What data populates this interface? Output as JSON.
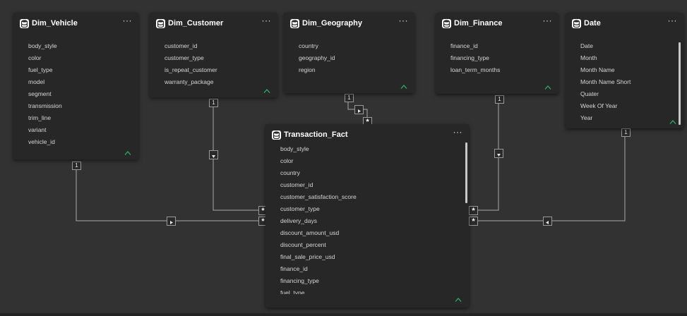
{
  "tables": {
    "dim_vehicle": {
      "title": "Dim_Vehicle",
      "fields": [
        "body_style",
        "color",
        "fuel_type",
        "model",
        "segment",
        "transmission",
        "trim_line",
        "variant",
        "vehicle_id"
      ]
    },
    "dim_customer": {
      "title": "Dim_Customer",
      "fields": [
        "customer_id",
        "customer_type",
        "is_repeat_customer",
        "warranty_package"
      ]
    },
    "dim_geography": {
      "title": "Dim_Geography",
      "fields": [
        "country",
        "geography_id",
        "region"
      ]
    },
    "dim_finance": {
      "title": "Dim_Finance",
      "fields": [
        "finance_id",
        "financing_type",
        "loan_term_months"
      ]
    },
    "date": {
      "title": "Date",
      "fields": [
        "Date",
        "Month",
        "Month Name",
        "Month Name Short",
        "Quater",
        "Week Of Year",
        "Year"
      ]
    },
    "transaction_fact": {
      "title": "Transaction_Fact",
      "fields": [
        "body_style",
        "color",
        "country",
        "customer_id",
        "customer_satisfaction_score",
        "customer_type",
        "delivery_days",
        "discount_amount_usd",
        "discount_percent",
        "final_sale_price_usd",
        "finance_id",
        "financing_type",
        "fuel_type"
      ]
    }
  },
  "cardinality": {
    "one": "1",
    "many": "*"
  },
  "icons": {
    "table": "table-icon",
    "more": "more-options-icon",
    "collapse": "collapse-icon",
    "filter_direction": "filter-direction-icon"
  },
  "colors": {
    "canvas": "#323232",
    "card": "#272727",
    "line": "#a8a8a8",
    "collapse_accent": "#2bb673"
  }
}
